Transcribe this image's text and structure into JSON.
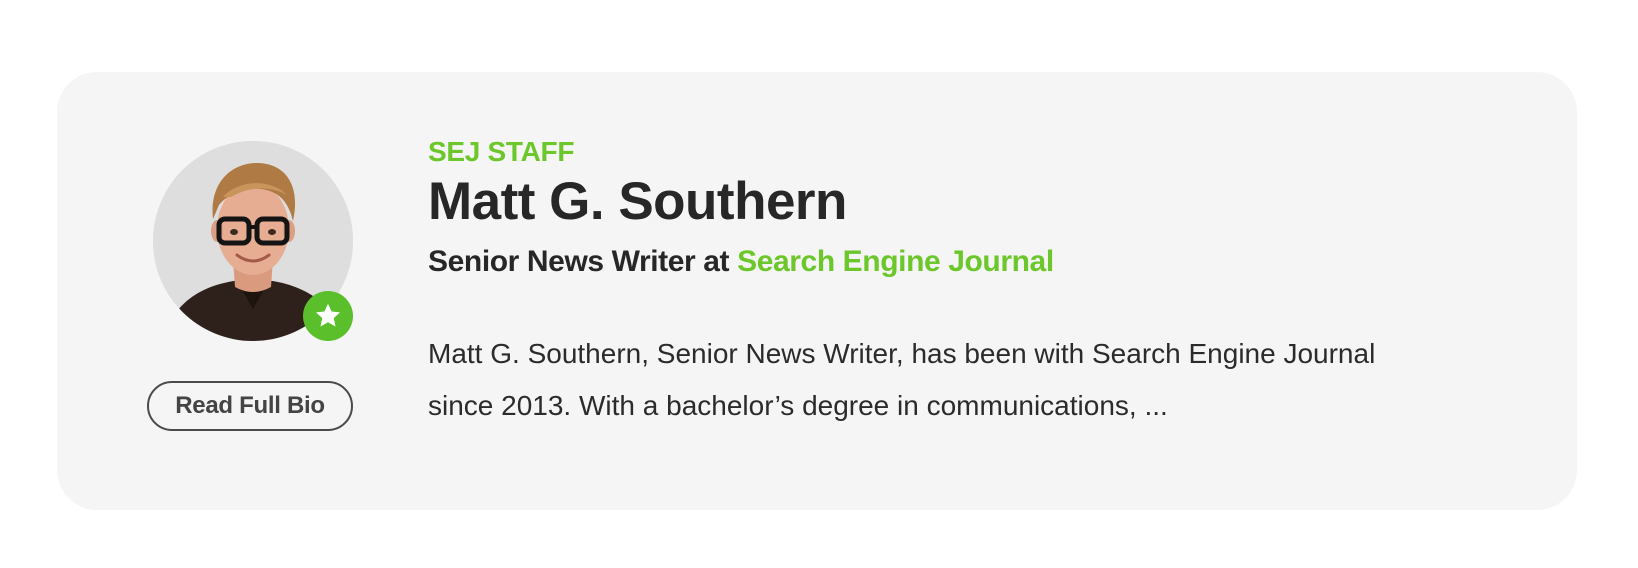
{
  "author_card": {
    "label": "SEJ STAFF",
    "name": "Matt G. Southern",
    "role_prefix": "Senior News Writer at",
    "organization": "Search Engine Journal",
    "description": "Matt G. Southern, Senior News Writer, has been with Search Engine Journal since 2013. With a bachelor’s degree in communications, ...",
    "read_bio_label": "Read Full Bio",
    "avatar_icon": "author-photo",
    "badge_icon": "star-icon"
  },
  "colors": {
    "accent": "#6cc72b",
    "badge": "#5bbf2c",
    "card_background": "#f4f5f4",
    "text": "#272727"
  }
}
